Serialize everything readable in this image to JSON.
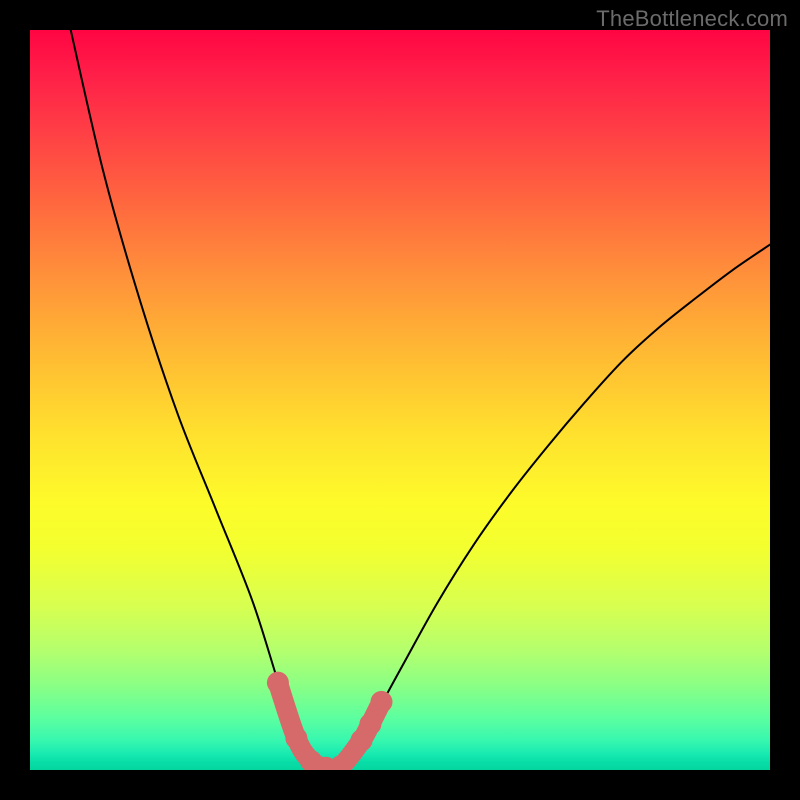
{
  "watermark": "TheBottleneck.com",
  "chart_data": {
    "type": "line",
    "title": "",
    "xlabel": "",
    "ylabel": "",
    "xlim": [
      0,
      1
    ],
    "ylim": [
      0,
      1
    ],
    "series": [
      {
        "name": "curve",
        "color": "#000000",
        "stroke_width": 2,
        "x": [
          0.055,
          0.1,
          0.15,
          0.2,
          0.25,
          0.3,
          0.335,
          0.36,
          0.38,
          0.4,
          0.42,
          0.45,
          0.5,
          0.55,
          0.6,
          0.65,
          0.7,
          0.75,
          0.8,
          0.85,
          0.9,
          0.95,
          1.0
        ],
        "y": [
          1.0,
          0.805,
          0.63,
          0.48,
          0.355,
          0.23,
          0.12,
          0.045,
          0.013,
          0.002,
          0.005,
          0.045,
          0.135,
          0.225,
          0.305,
          0.375,
          0.438,
          0.497,
          0.552,
          0.598,
          0.638,
          0.676,
          0.71
        ]
      }
    ],
    "markers": {
      "name": "highlight",
      "color": "#d66a6a",
      "radius": 11,
      "stroke_width": 20,
      "points_x": [
        0.335,
        0.36,
        0.38,
        0.4,
        0.42,
        0.448,
        0.46,
        0.475
      ],
      "points_y": [
        0.118,
        0.043,
        0.012,
        0.003,
        0.005,
        0.04,
        0.062,
        0.092
      ]
    },
    "gradient_stops": [
      {
        "pos": 0.0,
        "color": "#ff0543"
      },
      {
        "pos": 0.25,
        "color": "#ff7a3c"
      },
      {
        "pos": 0.55,
        "color": "#ffe22e"
      },
      {
        "pos": 0.8,
        "color": "#c5ff5d"
      },
      {
        "pos": 1.0,
        "color": "#05d69f"
      }
    ]
  }
}
